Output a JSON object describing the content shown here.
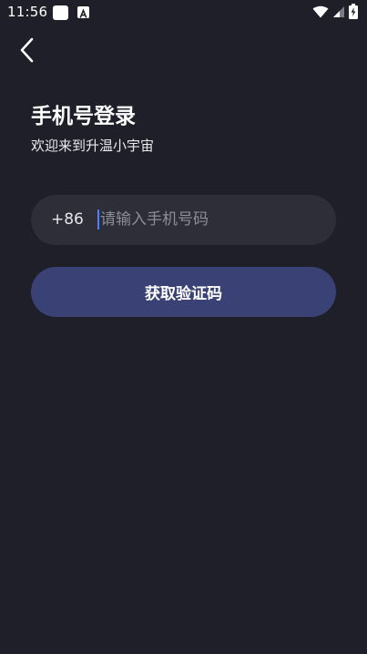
{
  "status_bar": {
    "time": "11:56",
    "icons": [
      "app-notification-icon",
      "app-a-icon",
      "wifi-icon",
      "cellular-signal-icon",
      "battery-charging-icon"
    ]
  },
  "header": {
    "back_icon": "chevron-left-icon"
  },
  "login": {
    "title": "手机号登录",
    "subtitle": "欢迎来到升温小宇宙",
    "country_code": "+86",
    "phone_placeholder": "请输入手机号码",
    "phone_value": "",
    "submit_label": "获取验证码"
  },
  "colors": {
    "background": "#1f1f29",
    "input_background": "#2e2e38",
    "button_background": "#3a4275",
    "cursor": "#4f7dff"
  }
}
